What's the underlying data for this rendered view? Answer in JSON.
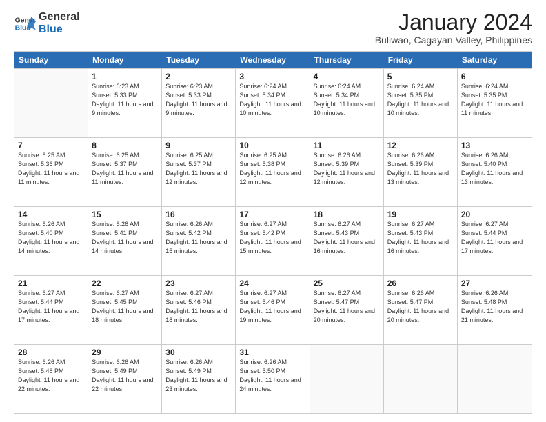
{
  "logo": {
    "line1": "General",
    "line2": "Blue"
  },
  "header": {
    "month": "January 2024",
    "location": "Buliwao, Cagayan Valley, Philippines"
  },
  "weekdays": [
    "Sunday",
    "Monday",
    "Tuesday",
    "Wednesday",
    "Thursday",
    "Friday",
    "Saturday"
  ],
  "weeks": [
    [
      {
        "day": "",
        "sunrise": "",
        "sunset": "",
        "daylight": ""
      },
      {
        "day": "1",
        "sunrise": "Sunrise: 6:23 AM",
        "sunset": "Sunset: 5:33 PM",
        "daylight": "Daylight: 11 hours and 9 minutes."
      },
      {
        "day": "2",
        "sunrise": "Sunrise: 6:23 AM",
        "sunset": "Sunset: 5:33 PM",
        "daylight": "Daylight: 11 hours and 9 minutes."
      },
      {
        "day": "3",
        "sunrise": "Sunrise: 6:24 AM",
        "sunset": "Sunset: 5:34 PM",
        "daylight": "Daylight: 11 hours and 10 minutes."
      },
      {
        "day": "4",
        "sunrise": "Sunrise: 6:24 AM",
        "sunset": "Sunset: 5:34 PM",
        "daylight": "Daylight: 11 hours and 10 minutes."
      },
      {
        "day": "5",
        "sunrise": "Sunrise: 6:24 AM",
        "sunset": "Sunset: 5:35 PM",
        "daylight": "Daylight: 11 hours and 10 minutes."
      },
      {
        "day": "6",
        "sunrise": "Sunrise: 6:24 AM",
        "sunset": "Sunset: 5:35 PM",
        "daylight": "Daylight: 11 hours and 11 minutes."
      }
    ],
    [
      {
        "day": "7",
        "sunrise": "Sunrise: 6:25 AM",
        "sunset": "Sunset: 5:36 PM",
        "daylight": "Daylight: 11 hours and 11 minutes."
      },
      {
        "day": "8",
        "sunrise": "Sunrise: 6:25 AM",
        "sunset": "Sunset: 5:37 PM",
        "daylight": "Daylight: 11 hours and 11 minutes."
      },
      {
        "day": "9",
        "sunrise": "Sunrise: 6:25 AM",
        "sunset": "Sunset: 5:37 PM",
        "daylight": "Daylight: 11 hours and 12 minutes."
      },
      {
        "day": "10",
        "sunrise": "Sunrise: 6:25 AM",
        "sunset": "Sunset: 5:38 PM",
        "daylight": "Daylight: 11 hours and 12 minutes."
      },
      {
        "day": "11",
        "sunrise": "Sunrise: 6:26 AM",
        "sunset": "Sunset: 5:39 PM",
        "daylight": "Daylight: 11 hours and 12 minutes."
      },
      {
        "day": "12",
        "sunrise": "Sunrise: 6:26 AM",
        "sunset": "Sunset: 5:39 PM",
        "daylight": "Daylight: 11 hours and 13 minutes."
      },
      {
        "day": "13",
        "sunrise": "Sunrise: 6:26 AM",
        "sunset": "Sunset: 5:40 PM",
        "daylight": "Daylight: 11 hours and 13 minutes."
      }
    ],
    [
      {
        "day": "14",
        "sunrise": "Sunrise: 6:26 AM",
        "sunset": "Sunset: 5:40 PM",
        "daylight": "Daylight: 11 hours and 14 minutes."
      },
      {
        "day": "15",
        "sunrise": "Sunrise: 6:26 AM",
        "sunset": "Sunset: 5:41 PM",
        "daylight": "Daylight: 11 hours and 14 minutes."
      },
      {
        "day": "16",
        "sunrise": "Sunrise: 6:26 AM",
        "sunset": "Sunset: 5:42 PM",
        "daylight": "Daylight: 11 hours and 15 minutes."
      },
      {
        "day": "17",
        "sunrise": "Sunrise: 6:27 AM",
        "sunset": "Sunset: 5:42 PM",
        "daylight": "Daylight: 11 hours and 15 minutes."
      },
      {
        "day": "18",
        "sunrise": "Sunrise: 6:27 AM",
        "sunset": "Sunset: 5:43 PM",
        "daylight": "Daylight: 11 hours and 16 minutes."
      },
      {
        "day": "19",
        "sunrise": "Sunrise: 6:27 AM",
        "sunset": "Sunset: 5:43 PM",
        "daylight": "Daylight: 11 hours and 16 minutes."
      },
      {
        "day": "20",
        "sunrise": "Sunrise: 6:27 AM",
        "sunset": "Sunset: 5:44 PM",
        "daylight": "Daylight: 11 hours and 17 minutes."
      }
    ],
    [
      {
        "day": "21",
        "sunrise": "Sunrise: 6:27 AM",
        "sunset": "Sunset: 5:44 PM",
        "daylight": "Daylight: 11 hours and 17 minutes."
      },
      {
        "day": "22",
        "sunrise": "Sunrise: 6:27 AM",
        "sunset": "Sunset: 5:45 PM",
        "daylight": "Daylight: 11 hours and 18 minutes."
      },
      {
        "day": "23",
        "sunrise": "Sunrise: 6:27 AM",
        "sunset": "Sunset: 5:46 PM",
        "daylight": "Daylight: 11 hours and 18 minutes."
      },
      {
        "day": "24",
        "sunrise": "Sunrise: 6:27 AM",
        "sunset": "Sunset: 5:46 PM",
        "daylight": "Daylight: 11 hours and 19 minutes."
      },
      {
        "day": "25",
        "sunrise": "Sunrise: 6:27 AM",
        "sunset": "Sunset: 5:47 PM",
        "daylight": "Daylight: 11 hours and 20 minutes."
      },
      {
        "day": "26",
        "sunrise": "Sunrise: 6:26 AM",
        "sunset": "Sunset: 5:47 PM",
        "daylight": "Daylight: 11 hours and 20 minutes."
      },
      {
        "day": "27",
        "sunrise": "Sunrise: 6:26 AM",
        "sunset": "Sunset: 5:48 PM",
        "daylight": "Daylight: 11 hours and 21 minutes."
      }
    ],
    [
      {
        "day": "28",
        "sunrise": "Sunrise: 6:26 AM",
        "sunset": "Sunset: 5:48 PM",
        "daylight": "Daylight: 11 hours and 22 minutes."
      },
      {
        "day": "29",
        "sunrise": "Sunrise: 6:26 AM",
        "sunset": "Sunset: 5:49 PM",
        "daylight": "Daylight: 11 hours and 22 minutes."
      },
      {
        "day": "30",
        "sunrise": "Sunrise: 6:26 AM",
        "sunset": "Sunset: 5:49 PM",
        "daylight": "Daylight: 11 hours and 23 minutes."
      },
      {
        "day": "31",
        "sunrise": "Sunrise: 6:26 AM",
        "sunset": "Sunset: 5:50 PM",
        "daylight": "Daylight: 11 hours and 24 minutes."
      },
      {
        "day": "",
        "sunrise": "",
        "sunset": "",
        "daylight": ""
      },
      {
        "day": "",
        "sunrise": "",
        "sunset": "",
        "daylight": ""
      },
      {
        "day": "",
        "sunrise": "",
        "sunset": "",
        "daylight": ""
      }
    ]
  ]
}
